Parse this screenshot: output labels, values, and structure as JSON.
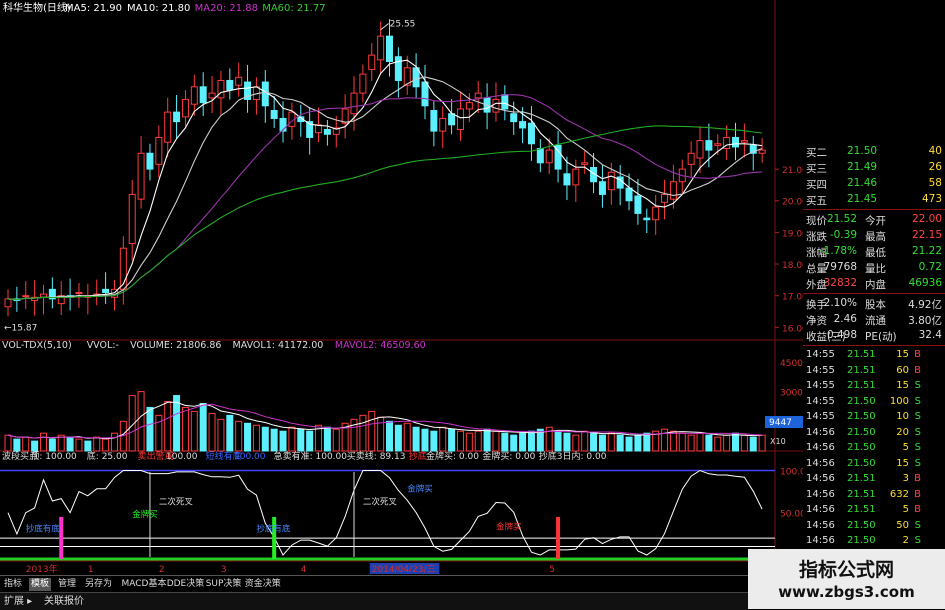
{
  "chart_data": {
    "type": "candlestick",
    "title": "科华生物(日线)",
    "ma_legend": [
      {
        "label": "MA5: 21.90",
        "color": "#ffffff"
      },
      {
        "label": "MA10: 21.80",
        "color": "#ffffff"
      },
      {
        "label": "MA20: 21.88",
        "color": "#cc33cc"
      },
      {
        "label": "MA60: 21.77",
        "color": "#33cc33"
      }
    ],
    "high_marker": "25.55",
    "low_marker": "15.87",
    "y_ticks": [
      "21.00",
      "20.00",
      "19.00",
      "18.00",
      "17.00",
      "16.00"
    ],
    "y_range": [
      15.6,
      25.9
    ],
    "closes": [
      16.9,
      16.85,
      17.0,
      16.95,
      17.05,
      16.9,
      17.0,
      16.95,
      17.1,
      17.0,
      17.05,
      17.1,
      17.2,
      18.5,
      20.2,
      21.5,
      21.0,
      22.0,
      22.8,
      22.5,
      23.2,
      23.6,
      23.1,
      23.4,
      23.8,
      23.5,
      23.9,
      23.2,
      23.6,
      23.0,
      22.6,
      22.2,
      22.8,
      22.5,
      22.0,
      22.4,
      22.1,
      22.3,
      22.9,
      23.4,
      24.0,
      24.6,
      25.2,
      24.4,
      23.8,
      24.2,
      23.6,
      23.0,
      22.2,
      22.6,
      22.4,
      22.9,
      23.1,
      23.4,
      22.8,
      23.2,
      22.9,
      22.5,
      22.3,
      21.8,
      21.2,
      21.6,
      21.0,
      20.5,
      21.0,
      21.2,
      20.6,
      20.2,
      20.9,
      20.4,
      20.0,
      19.6,
      19.4,
      19.8,
      20.2,
      20.6,
      21.0,
      21.5,
      21.9,
      21.6,
      21.8,
      22.0,
      21.7,
      21.9,
      21.5,
      21.6
    ],
    "series": [
      {
        "name": "MA5",
        "color": "#ffffff"
      },
      {
        "name": "MA10",
        "color": "#cfcfcf"
      },
      {
        "name": "MA20",
        "color": "#9933aa"
      },
      {
        "name": "MA60",
        "color": "#22aa22"
      }
    ]
  },
  "volume_panel": {
    "header": [
      {
        "text": "VOL-TDX(5,10)",
        "color": "#dddddd"
      },
      {
        "text": "VVOL:-",
        "color": "#dddddd"
      },
      {
        "text": "VOLUME: 21806.86",
        "color": "#dddddd"
      },
      {
        "text": "MAVOL1: 41172.00",
        "color": "#dddddd"
      },
      {
        "text": "MAVOL2: 46509.60",
        "color": "#cc33cc"
      }
    ],
    "y_ticks": [
      "45000",
      "30000",
      "15000"
    ],
    "right_label": "9447",
    "unit_label": "X10",
    "values": [
      8,
      6,
      7,
      5,
      9,
      6,
      8,
      7,
      6,
      5,
      7,
      6,
      9,
      15,
      28,
      30,
      22,
      18,
      25,
      28,
      22,
      20,
      24,
      19,
      16,
      18,
      15,
      14,
      13,
      12,
      11,
      10,
      12,
      11,
      10,
      13,
      12,
      11,
      14,
      16,
      18,
      20,
      17,
      15,
      13,
      14,
      12,
      11,
      10,
      12,
      11,
      10,
      9,
      10,
      11,
      10,
      9,
      8,
      9,
      10,
      11,
      12,
      10,
      9,
      8,
      10,
      9,
      8,
      9,
      8,
      7,
      8,
      9,
      10,
      11,
      10,
      9,
      8,
      9,
      8,
      7,
      8,
      9,
      8,
      7,
      8
    ]
  },
  "indicator_panel": {
    "header": [
      {
        "text": "波段买点",
        "color": "#dddddd"
      },
      {
        "text": "顶: 100.00",
        "color": "#dddddd"
      },
      {
        "text": "底: 25.00",
        "color": "#dddddd"
      },
      {
        "text": "卖出警戒",
        "color": "#ff3333"
      },
      {
        "text": "100.00",
        "color": "#dddddd"
      },
      {
        "text": "短线有底",
        "color": "#3366ff"
      },
      {
        "text": "100.00",
        "color": "#3366ff"
      },
      {
        "text": "急卖有准: 100.00",
        "color": "#dddddd"
      },
      {
        "text": "买卖线: 89.13",
        "color": "#dddddd"
      },
      {
        "text": "抄底",
        "color": "#ff3333"
      },
      {
        "text": "金牌买: 0.00",
        "color": "#dddddd"
      },
      {
        "text": "金牌买: 0.00",
        "color": "#dddddd"
      },
      {
        "text": "抄底3日内: 0.00",
        "color": "#dddddd"
      }
    ],
    "y_ticks": [
      "100.0",
      "50.00"
    ],
    "annotations": [
      "二次死叉",
      "二次死叉",
      "金牌买",
      "金牌买",
      "抄底有底",
      "抄底有底",
      "金牌买"
    ]
  },
  "time_axis": {
    "labels": [
      "2013年",
      "1",
      "2",
      "3",
      "4",
      "2014/04/23/三",
      "5"
    ]
  },
  "quote_panel": {
    "bids": [
      {
        "label": "买二",
        "price": "21.50",
        "vol": "40"
      },
      {
        "label": "买三",
        "price": "21.49",
        "vol": "26"
      },
      {
        "label": "买四",
        "price": "21.46",
        "vol": "58"
      },
      {
        "label": "买五",
        "price": "21.45",
        "vol": "473"
      }
    ],
    "stats": [
      {
        "l1": "现价",
        "v1": "21.52",
        "l2": "今开",
        "v2": "22.00",
        "c1": "#33dd33",
        "c2": "#ff4444"
      },
      {
        "l1": "涨跌",
        "v1": "-0.39",
        "l2": "最高",
        "v2": "22.15",
        "c1": "#33dd33",
        "c2": "#ff4444"
      },
      {
        "l1": "涨幅",
        "v1": "-1.78%",
        "l2": "最低",
        "v2": "21.22",
        "c1": "#33dd33",
        "c2": "#33dd33"
      },
      {
        "l1": "总量",
        "v1": "79768",
        "l2": "量比",
        "v2": "0.72",
        "c1": "#dddddd",
        "c2": "#33dd33"
      },
      {
        "l1": "外盘",
        "v1": "32832",
        "l2": "内盘",
        "v2": "46936",
        "c1": "#ff4444",
        "c2": "#33dd33"
      }
    ],
    "info": [
      {
        "l1": "换手",
        "v1": "2.10%",
        "l2": "股本",
        "v2": "4.92亿"
      },
      {
        "l1": "净资",
        "v1": "2.46",
        "l2": "流通",
        "v2": "3.80亿"
      },
      {
        "l1": "收益(三)",
        "v1": "0.498",
        "l2": "PE(动)",
        "v2": "32.4"
      }
    ],
    "ticks": [
      {
        "time": "14:55",
        "price": "21.51",
        "vol": "15",
        "side": "B"
      },
      {
        "time": "14:55",
        "price": "21.51",
        "vol": "60",
        "side": "B"
      },
      {
        "time": "14:55",
        "price": "21.51",
        "vol": "15",
        "side": "S"
      },
      {
        "time": "14:55",
        "price": "21.50",
        "vol": "100",
        "side": "S"
      },
      {
        "time": "14:55",
        "price": "21.50",
        "vol": "10",
        "side": "S"
      },
      {
        "time": "14:56",
        "price": "21.50",
        "vol": "20",
        "side": "S"
      },
      {
        "time": "14:56",
        "price": "21.50",
        "vol": "5",
        "side": "S"
      },
      {
        "time": "14:56",
        "price": "21.50",
        "vol": "15",
        "side": "S"
      },
      {
        "time": "14:56",
        "price": "21.51",
        "vol": "3",
        "side": "B"
      },
      {
        "time": "14:56",
        "price": "21.51",
        "vol": "632",
        "side": "B"
      },
      {
        "time": "14:56",
        "price": "21.51",
        "vol": "5",
        "side": "B"
      },
      {
        "time": "14:56",
        "price": "21.50",
        "vol": "50",
        "side": "S"
      },
      {
        "time": "14:56",
        "price": "21.50",
        "vol": "2",
        "side": "S"
      },
      {
        "time": "14:56",
        "price": "21.51",
        "vol": "10",
        "side": "B"
      }
    ]
  },
  "tabs": [
    "指标",
    "模板",
    "管理",
    "另存为",
    "MACD基本",
    "DDE决策",
    "SUP决策",
    "资金决策"
  ],
  "bottom_tabs": [
    "扩展",
    "关联报价"
  ],
  "watermark": {
    "line1": "指标公式网",
    "line2": "www.zbgs3.com"
  }
}
